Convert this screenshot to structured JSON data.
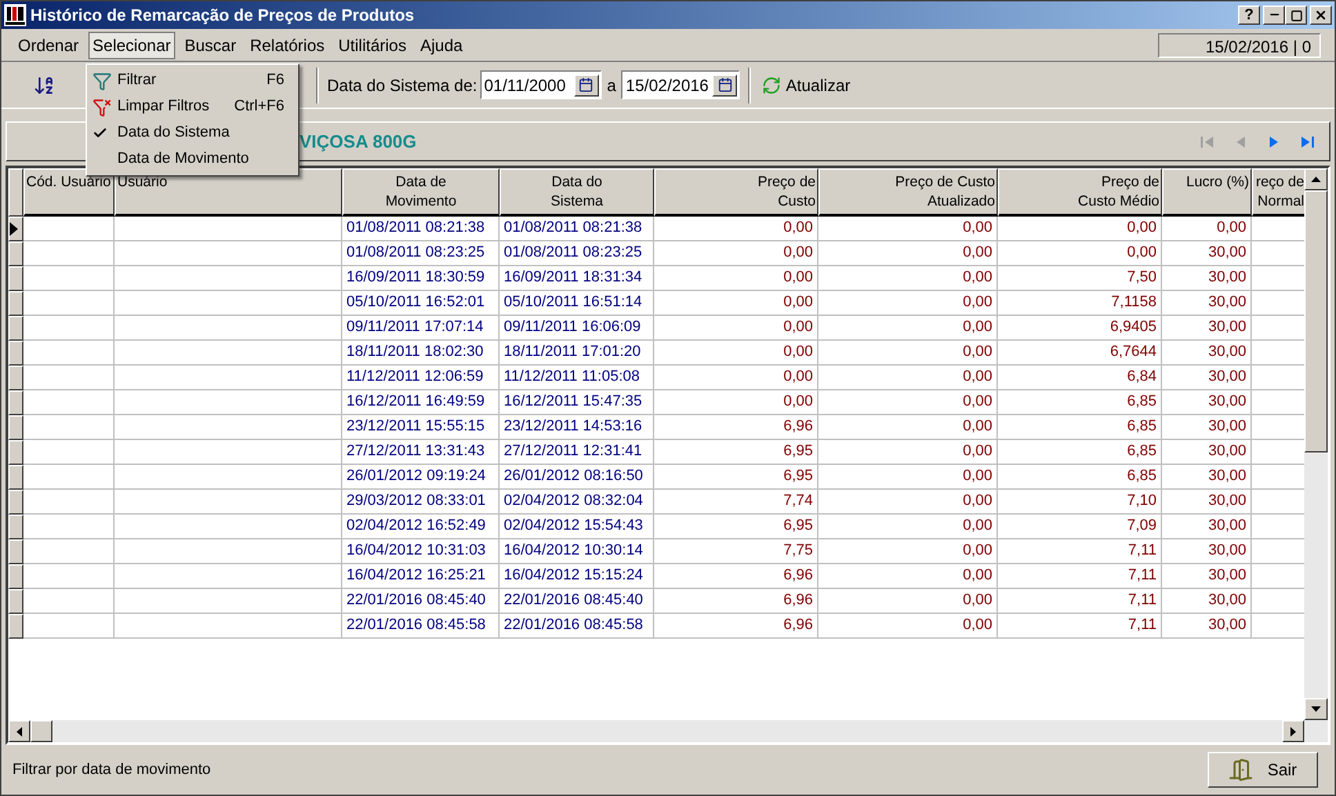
{
  "window": {
    "title": "Histórico de Remarcação de Preços de Produtos",
    "help": "?"
  },
  "menu_bar": [
    {
      "label": "Ordenar",
      "open": false
    },
    {
      "label": "Selecionar",
      "open": true
    },
    {
      "label": "Buscar",
      "open": false
    },
    {
      "label": "Relatórios",
      "open": false
    },
    {
      "label": "Utilitários",
      "open": false
    },
    {
      "label": "Ajuda",
      "open": false
    }
  ],
  "session_info": "15/02/2016 | 0",
  "open_menu": [
    {
      "kind": "filter",
      "label": "Filtrar",
      "shortcut": "F6"
    },
    {
      "kind": "clear-filter",
      "label": "Limpar Filtros",
      "shortcut": "Ctrl+F6"
    },
    {
      "kind": "option",
      "label": "Data do Sistema",
      "checked": true
    },
    {
      "kind": "option",
      "label": "Data de Movimento",
      "checked": false
    }
  ],
  "toolbar": {
    "date_label": "Data do Sistema de:",
    "date_from": "01/11/2000",
    "between": "a",
    "date_to": "15/02/2016",
    "refresh": "Atualizar"
  },
  "product": "VIÇOSA 800G",
  "navigator": [
    {
      "kind": "first",
      "disabled": true
    },
    {
      "kind": "prior",
      "disabled": true
    },
    {
      "kind": "next",
      "disabled": false
    },
    {
      "kind": "last",
      "disabled": false
    }
  ],
  "table": {
    "columns": [
      {
        "label": "Cód. Usuário",
        "kind": "text"
      },
      {
        "label": "Usuário",
        "kind": "text"
      },
      {
        "label": "Data de\nMovimento",
        "kind": "date"
      },
      {
        "label": "Data do\nSistema",
        "kind": "date"
      },
      {
        "label": "Preço de\nCusto",
        "kind": "number"
      },
      {
        "label": "Preço de Custo\nAtualizado",
        "kind": "number"
      },
      {
        "label": "Preço de\nCusto Médio",
        "kind": "number"
      },
      {
        "label": "Lucro (%)",
        "kind": "number"
      },
      {
        "label": "reço de\nNormal",
        "kind": "number"
      }
    ],
    "rows": [
      {
        "current": true,
        "cells": [
          null,
          null,
          "01/08/2011 08:21:38",
          "01/08/2011 08:21:38",
          "0,00",
          "0,00",
          "0,00",
          "0,00",
          null
        ]
      },
      {
        "current": false,
        "cells": [
          null,
          null,
          "01/08/2011 08:23:25",
          "01/08/2011 08:23:25",
          "0,00",
          "0,00",
          "0,00",
          "30,00",
          null
        ]
      },
      {
        "current": false,
        "cells": [
          null,
          null,
          "16/09/2011 18:30:59",
          "16/09/2011 18:31:34",
          "0,00",
          "0,00",
          "7,50",
          "30,00",
          null
        ]
      },
      {
        "current": false,
        "cells": [
          null,
          null,
          "05/10/2011 16:52:01",
          "05/10/2011 16:51:14",
          "0,00",
          "0,00",
          "7,1158",
          "30,00",
          null
        ]
      },
      {
        "current": false,
        "cells": [
          null,
          null,
          "09/11/2011 17:07:14",
          "09/11/2011 16:06:09",
          "0,00",
          "0,00",
          "6,9405",
          "30,00",
          null
        ]
      },
      {
        "current": false,
        "cells": [
          null,
          null,
          "18/11/2011 18:02:30",
          "18/11/2011 17:01:20",
          "0,00",
          "0,00",
          "6,7644",
          "30,00",
          null
        ]
      },
      {
        "current": false,
        "cells": [
          null,
          null,
          "11/12/2011 12:06:59",
          "11/12/2011 11:05:08",
          "0,00",
          "0,00",
          "6,84",
          "30,00",
          null
        ]
      },
      {
        "current": false,
        "cells": [
          null,
          null,
          "16/12/2011 16:49:59",
          "16/12/2011 15:47:35",
          "0,00",
          "0,00",
          "6,85",
          "30,00",
          null
        ]
      },
      {
        "current": false,
        "cells": [
          null,
          null,
          "23/12/2011 15:55:15",
          "23/12/2011 14:53:16",
          "6,96",
          "0,00",
          "6,85",
          "30,00",
          null
        ]
      },
      {
        "current": false,
        "cells": [
          null,
          null,
          "27/12/2011 13:31:43",
          "27/12/2011 12:31:41",
          "6,95",
          "0,00",
          "6,85",
          "30,00",
          null
        ]
      },
      {
        "current": false,
        "cells": [
          null,
          null,
          "26/01/2012 09:19:24",
          "26/01/2012 08:16:50",
          "6,95",
          "0,00",
          "6,85",
          "30,00",
          null
        ]
      },
      {
        "current": false,
        "cells": [
          null,
          null,
          "29/03/2012 08:33:01",
          "02/04/2012 08:32:04",
          "7,74",
          "0,00",
          "7,10",
          "30,00",
          null
        ]
      },
      {
        "current": false,
        "cells": [
          null,
          null,
          "02/04/2012 16:52:49",
          "02/04/2012 15:54:43",
          "6,95",
          "0,00",
          "7,09",
          "30,00",
          null
        ]
      },
      {
        "current": false,
        "cells": [
          null,
          null,
          "16/04/2012 10:31:03",
          "16/04/2012 10:30:14",
          "7,75",
          "0,00",
          "7,11",
          "30,00",
          null
        ]
      },
      {
        "current": false,
        "cells": [
          null,
          null,
          "16/04/2012 16:25:21",
          "16/04/2012 15:15:24",
          "6,96",
          "0,00",
          "7,11",
          "30,00",
          null
        ]
      },
      {
        "current": false,
        "cells": [
          null,
          null,
          "22/01/2016 08:45:40",
          "22/01/2016 08:45:40",
          "6,96",
          "0,00",
          "7,11",
          "30,00",
          null
        ]
      },
      {
        "current": false,
        "cells": [
          null,
          null,
          "22/01/2016 08:45:58",
          "22/01/2016 08:45:58",
          "6,96",
          "0,00",
          "7,11",
          "30,00",
          null
        ]
      }
    ]
  },
  "status_bar": {
    "message": "Filtrar por data de movimento",
    "exit": "Sair"
  }
}
